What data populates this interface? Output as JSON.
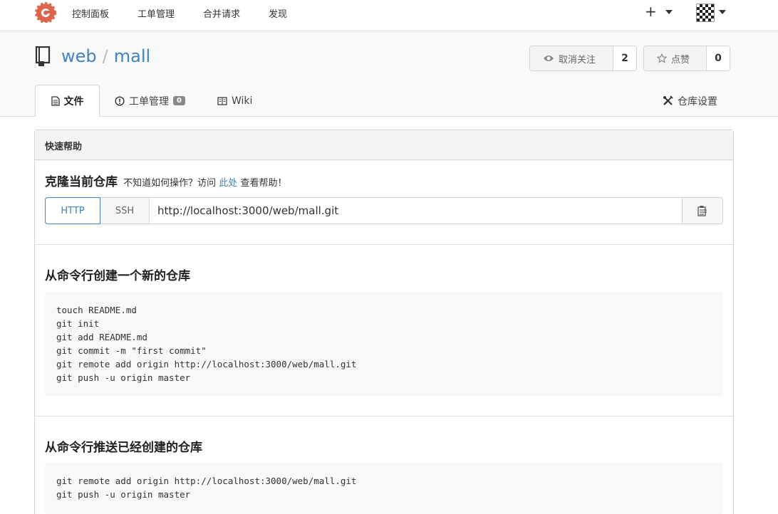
{
  "nav": {
    "items": [
      "控制面板",
      "工单管理",
      "合并请求",
      "发现"
    ],
    "plus_label": "+"
  },
  "repo": {
    "owner": "web",
    "separator": "/",
    "name": "mall"
  },
  "actions": {
    "unwatch_label": "取消关注",
    "unwatch_count": "2",
    "star_label": "点赞",
    "star_count": "0"
  },
  "tabs": {
    "files_label": "文件",
    "issues_label": "工单管理",
    "issues_count": "0",
    "wiki_label": "Wiki",
    "settings_label": "仓库设置"
  },
  "quick_help": {
    "header": "快速帮助",
    "clone_title": "克隆当前仓库",
    "hint_prefix": "不知道如何操作？访问",
    "hint_link": "此处",
    "hint_suffix": "查看帮助！",
    "http_label": "HTTP",
    "ssh_label": "SSH",
    "clone_url": "http://localhost:3000/web/mall.git"
  },
  "new_repo": {
    "title": "从命令行创建一个新的仓库",
    "lines": [
      "touch README.md",
      "git init",
      "git add README.md",
      "git commit -m \"first commit\"",
      "git remote add origin http://localhost:3000/web/mall.git",
      "git push -u origin master"
    ]
  },
  "existing_repo": {
    "title": "从命令行推送已经创建的仓库",
    "lines": [
      "git remote add origin http://localhost:3000/web/mall.git",
      "git push -u origin master"
    ]
  },
  "colors": {
    "accent": "#4183c4",
    "logo": "#e0634b"
  },
  "icons": [
    "gitea-logo-icon",
    "plus-icon",
    "caret-down-icon",
    "avatar",
    "repo-book-icon",
    "eye-icon",
    "star-icon",
    "file-text-icon",
    "issue-circle-icon",
    "wiki-book-icon",
    "tools-icon",
    "clipboard-icon"
  ]
}
